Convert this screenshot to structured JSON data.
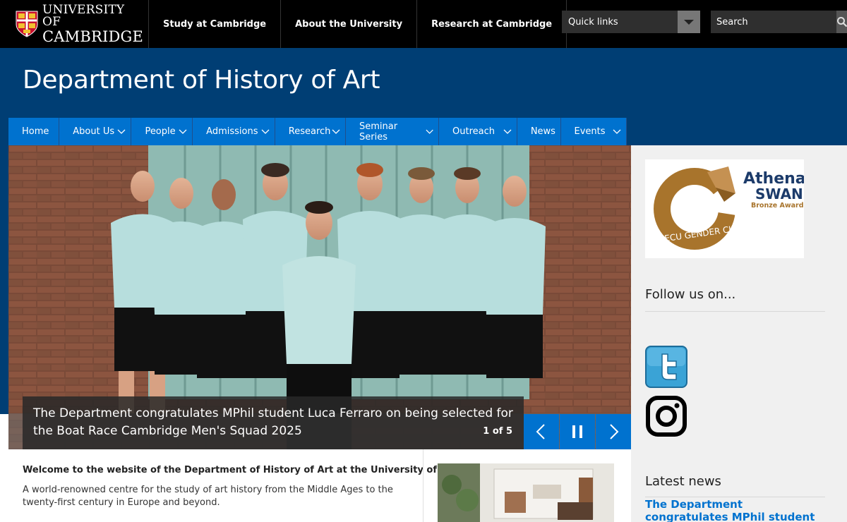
{
  "logo": {
    "line1": "UNIVERSITY OF",
    "line2": "CAMBRIDGE"
  },
  "topnav": [
    {
      "label": "Study at Cambridge"
    },
    {
      "label": "About the University"
    },
    {
      "label": "Research at Cambridge"
    }
  ],
  "quicklinks": {
    "label": "Quick links"
  },
  "search": {
    "placeholder": "Search"
  },
  "department": {
    "title": "Department of History of Art"
  },
  "mainnav": [
    {
      "label": "Home",
      "dropdown": false,
      "active": true
    },
    {
      "label": "About Us",
      "dropdown": true
    },
    {
      "label": "People",
      "dropdown": true
    },
    {
      "label": "Admissions",
      "dropdown": true
    },
    {
      "label": "Research",
      "dropdown": true
    },
    {
      "label": "Seminar Series",
      "dropdown": true
    },
    {
      "label": "Outreach",
      "dropdown": true
    },
    {
      "label": "News",
      "dropdown": false
    },
    {
      "label": "Events",
      "dropdown": true
    }
  ],
  "carousel": {
    "caption": "The Department congratulates MPhil student Luca Ferraro on being selected for the Boat Race Cambridge Men's Squad 2025",
    "counter": "1 of 5"
  },
  "sidebar": {
    "athena": {
      "line1": "Athena",
      "line2": "SWAN",
      "award": "Bronze Award",
      "ring_text": "ECU GENDER CHARTER"
    },
    "follow_heading": "Follow us on...",
    "latest_heading": "Latest news",
    "latest_item": "The Department congratulates MPhil student Luca Ferraro on"
  },
  "main": {
    "welcome_heading": "Welcome to the website of the Department of History of Art at the University of Cambridge",
    "intro": "A world-renowned centre for the study of art history from the Middle Ages to the twenty-first century in Europe and beyond."
  },
  "colors": {
    "black": "#000000",
    "cambridge_blue_dark": "#003e74",
    "nav_blue": "#0072cf",
    "athena_brown": "#a8742c",
    "athena_navy": "#1c3b6a"
  },
  "icons": [
    "crest-icon",
    "chevron-down-icon",
    "search-icon",
    "chevron-left-icon",
    "pause-icon",
    "chevron-right-icon",
    "twitter-icon",
    "instagram-icon"
  ]
}
